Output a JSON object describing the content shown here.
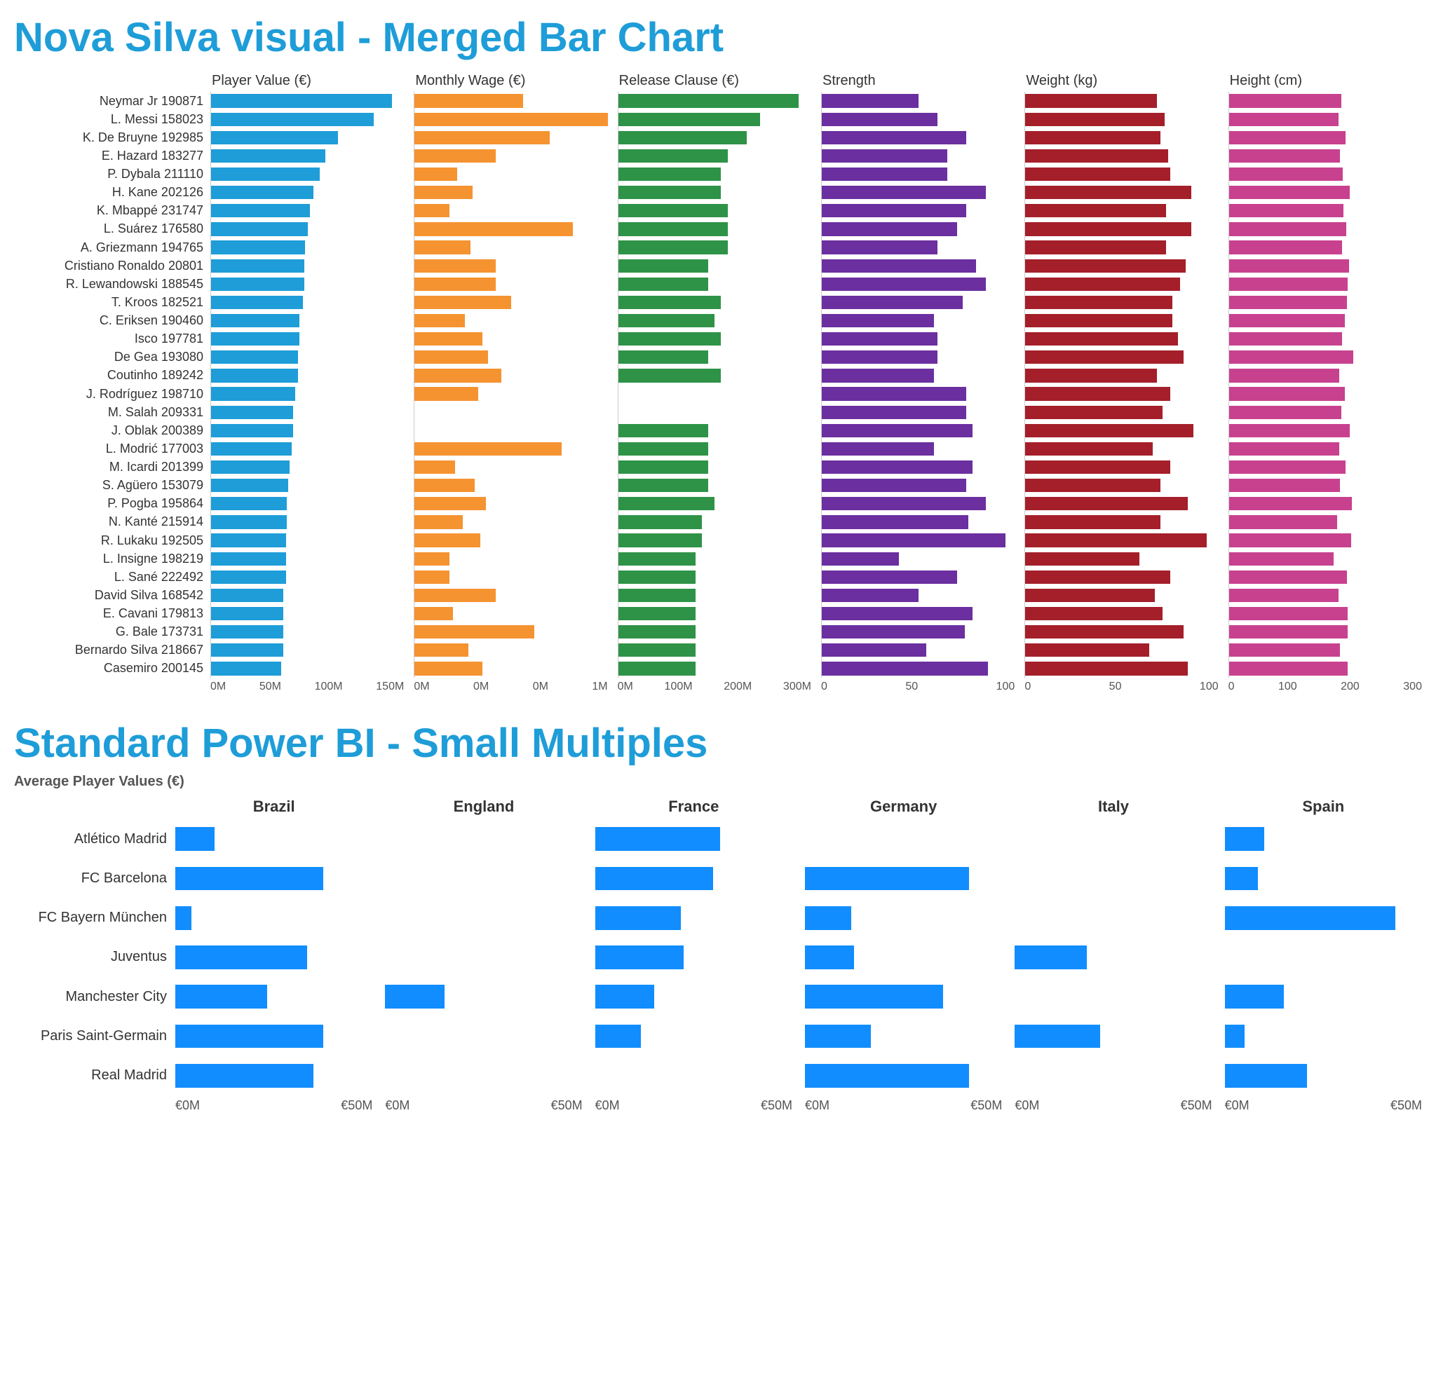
{
  "titles": {
    "merged": "Nova Silva visual - Merged Bar Chart",
    "small_multiples": "Standard Power BI - Small Multiples",
    "sm_subtitle": "Average Player Values (€)"
  },
  "chart_data": [
    {
      "id": "merged_bar",
      "type": "bar",
      "orientation": "horizontal",
      "categories": [
        "Neymar Jr 190871",
        "L. Messi 158023",
        "K. De Bruyne 192985",
        "E. Hazard 183277",
        "P. Dybala 211110",
        "H. Kane 202126",
        "K. Mbappé 231747",
        "L. Suárez 176580",
        "A. Griezmann 194765",
        "Cristiano Ronaldo 20801",
        "R. Lewandowski 188545",
        "T. Kroos 182521",
        "C. Eriksen 190460",
        "Isco 197781",
        "De Gea 193080",
        "Coutinho 189242",
        "J. Rodríguez 198710",
        "M. Salah 209331",
        "J. Oblak 200389",
        "L. Modrić 177003",
        "M. Icardi 201399",
        "S. Agüero 153079",
        "P. Pogba 195864",
        "N. Kanté 215914",
        "R. Lukaku 192505",
        "L. Insigne 198219",
        "L. Sané 222492",
        "David Silva 168542",
        "E. Cavani 179813",
        "G. Bale 173731",
        "Bernardo Silva 218667",
        "Casemiro 200145"
      ],
      "series": [
        {
          "name": "Player Value (€)",
          "color": "#1e9dd8",
          "xlim": [
            0,
            160000000
          ],
          "ticks": [
            "0M",
            "50M",
            "100M",
            "150M"
          ],
          "values": [
            150000000,
            135000000,
            105000000,
            95000000,
            90000000,
            85000000,
            82000000,
            80000000,
            78000000,
            77000000,
            77000000,
            76000000,
            73000000,
            73000000,
            72000000,
            72000000,
            70000000,
            68000000,
            68000000,
            67000000,
            65000000,
            64000000,
            63000000,
            63000000,
            62000000,
            62000000,
            62000000,
            60000000,
            60000000,
            60000000,
            60000000,
            58000000
          ]
        },
        {
          "name": "Monthly Wage (€)",
          "color": "#f59331",
          "xlim": [
            0,
            1000000
          ],
          "ticks": [
            "0M",
            "0M",
            "0M",
            "1M"
          ],
          "values": [
            560000,
            1000000,
            700000,
            420000,
            220000,
            300000,
            180000,
            820000,
            290000,
            420000,
            420000,
            500000,
            260000,
            350000,
            380000,
            450000,
            330000,
            null,
            null,
            760000,
            210000,
            310000,
            370000,
            250000,
            340000,
            180000,
            180000,
            420000,
            200000,
            620000,
            280000,
            350000
          ]
        },
        {
          "name": "Release Clause (€)",
          "color": "#2e9347",
          "xlim": [
            0,
            300000000
          ],
          "ticks": [
            "0M",
            "100M",
            "200M",
            "300M"
          ],
          "values": [
            280000000,
            220000000,
            200000000,
            170000000,
            160000000,
            160000000,
            170000000,
            170000000,
            170000000,
            140000000,
            140000000,
            160000000,
            150000000,
            160000000,
            140000000,
            160000000,
            null,
            null,
            140000000,
            140000000,
            140000000,
            140000000,
            150000000,
            130000000,
            130000000,
            120000000,
            120000000,
            120000000,
            120000000,
            120000000,
            120000000,
            120000000
          ]
        },
        {
          "name": "Strength",
          "color": "#6b2fa0",
          "xlim": [
            0,
            100
          ],
          "ticks": [
            "0",
            "50",
            "100"
          ],
          "values": [
            50,
            60,
            75,
            65,
            65,
            85,
            75,
            70,
            60,
            80,
            85,
            73,
            58,
            60,
            60,
            58,
            75,
            75,
            78,
            58,
            78,
            75,
            85,
            76,
            95,
            40,
            70,
            50,
            78,
            74,
            54,
            86
          ]
        },
        {
          "name": "Weight (kg)",
          "color": "#a41f2a",
          "xlim": [
            0,
            100
          ],
          "ticks": [
            "0",
            "50",
            "100"
          ],
          "values": [
            68,
            72,
            70,
            74,
            75,
            86,
            73,
            86,
            73,
            83,
            80,
            76,
            76,
            79,
            82,
            68,
            75,
            71,
            87,
            66,
            75,
            70,
            84,
            70,
            94,
            59,
            75,
            67,
            71,
            82,
            64,
            84
          ]
        },
        {
          "name": "Height (cm)",
          "color": "#c8418f",
          "xlim": [
            0,
            300
          ],
          "ticks": [
            "0",
            "100",
            "200",
            "300"
          ],
          "values": [
            175,
            170,
            181,
            173,
            177,
            188,
            178,
            182,
            176,
            187,
            184,
            183,
            180,
            176,
            193,
            172,
            180,
            175,
            188,
            172,
            181,
            173,
            191,
            168,
            190,
            163,
            183,
            170,
            184,
            185,
            173,
            185
          ]
        }
      ]
    },
    {
      "id": "small_multiples",
      "type": "bar",
      "orientation": "horizontal",
      "title": "Average Player Values (€)",
      "row_categories": [
        "Atlético Madrid",
        "FC Barcelona",
        "FC Bayern München",
        "Juventus",
        "Manchester City",
        "Paris Saint-Germain",
        "Real Madrid"
      ],
      "col_categories": [
        "Brazil",
        "England",
        "France",
        "Germany",
        "Italy",
        "Spain"
      ],
      "xlim": [
        0,
        60000000
      ],
      "ticks": [
        "€0M",
        "€50M"
      ],
      "color": "#118dff",
      "values": [
        [
          12000000,
          null,
          38000000,
          null,
          null,
          12000000
        ],
        [
          45000000,
          null,
          36000000,
          50000000,
          null,
          10000000
        ],
        [
          5000000,
          null,
          26000000,
          14000000,
          null,
          52000000
        ],
        [
          40000000,
          null,
          27000000,
          15000000,
          22000000,
          null
        ],
        [
          28000000,
          18000000,
          18000000,
          42000000,
          null,
          18000000
        ],
        [
          45000000,
          null,
          14000000,
          20000000,
          26000000,
          6000000
        ],
        [
          42000000,
          null,
          null,
          50000000,
          null,
          25000000
        ]
      ]
    }
  ]
}
